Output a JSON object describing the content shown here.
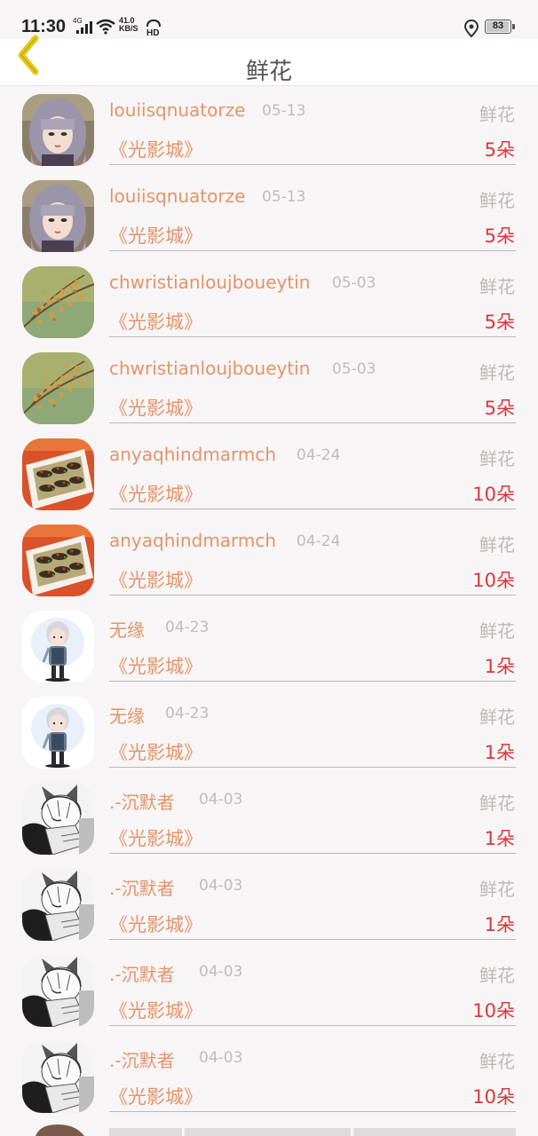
{
  "status": {
    "time": "11:30",
    "network": "4G",
    "speed_value": "41.0",
    "speed_unit": "KB/S",
    "battery": "83"
  },
  "header": {
    "title": "鲜花"
  },
  "items": [
    {
      "username": "louiisqnuatorze",
      "date": "05-13",
      "gift": "鲜花",
      "work": "《光影城》",
      "count": "5朵",
      "avatar": "girl-silver-hair"
    },
    {
      "username": "louiisqnuatorze",
      "date": "05-13",
      "gift": "鲜花",
      "work": "《光影城》",
      "count": "5朵",
      "avatar": "girl-silver-hair"
    },
    {
      "username": "chwristianloujboueytin",
      "date": "05-03",
      "gift": "鲜花",
      "work": "《光影城》",
      "count": "5朵",
      "avatar": "autumn-blossoms"
    },
    {
      "username": "chwristianloujboueytin",
      "date": "05-03",
      "gift": "鲜花",
      "work": "《光影城》",
      "count": "5朵",
      "avatar": "autumn-blossoms"
    },
    {
      "username": "anyaqhindmarmch",
      "date": "04-24",
      "gift": "鲜花",
      "work": "《光影城》",
      "count": "10朵",
      "avatar": "food-tray"
    },
    {
      "username": "anyaqhindmarmch",
      "date": "04-24",
      "gift": "鲜花",
      "work": "《光影城》",
      "count": "10朵",
      "avatar": "food-tray"
    },
    {
      "username": "无缘",
      "date": "04-23",
      "gift": "鲜花",
      "work": "《光影城》",
      "count": "1朵",
      "avatar": "chibi-white-hair"
    },
    {
      "username": "无缘",
      "date": "04-23",
      "gift": "鲜花",
      "work": "《光影城》",
      "count": "1朵",
      "avatar": "chibi-white-hair"
    },
    {
      "username": ".-沉默者",
      "date": "04-03",
      "gift": "鲜花",
      "work": "《光影城》",
      "count": "1朵",
      "avatar": "sketch-cat-ears"
    },
    {
      "username": ".-沉默者",
      "date": "04-03",
      "gift": "鲜花",
      "work": "《光影城》",
      "count": "1朵",
      "avatar": "sketch-cat-ears"
    },
    {
      "username": ".-沉默者",
      "date": "04-03",
      "gift": "鲜花",
      "work": "《光影城》",
      "count": "10朵",
      "avatar": "sketch-cat-ears"
    },
    {
      "username": ".-沉默者",
      "date": "04-03",
      "gift": "鲜花",
      "work": "《光影城》",
      "count": "10朵",
      "avatar": "sketch-cat-ears"
    }
  ],
  "colors": {
    "username": "#e3946a",
    "count": "#d9383c",
    "muted": "#bdb8b8",
    "background": "#f7f5f5",
    "back_icon": "#e8c818"
  }
}
